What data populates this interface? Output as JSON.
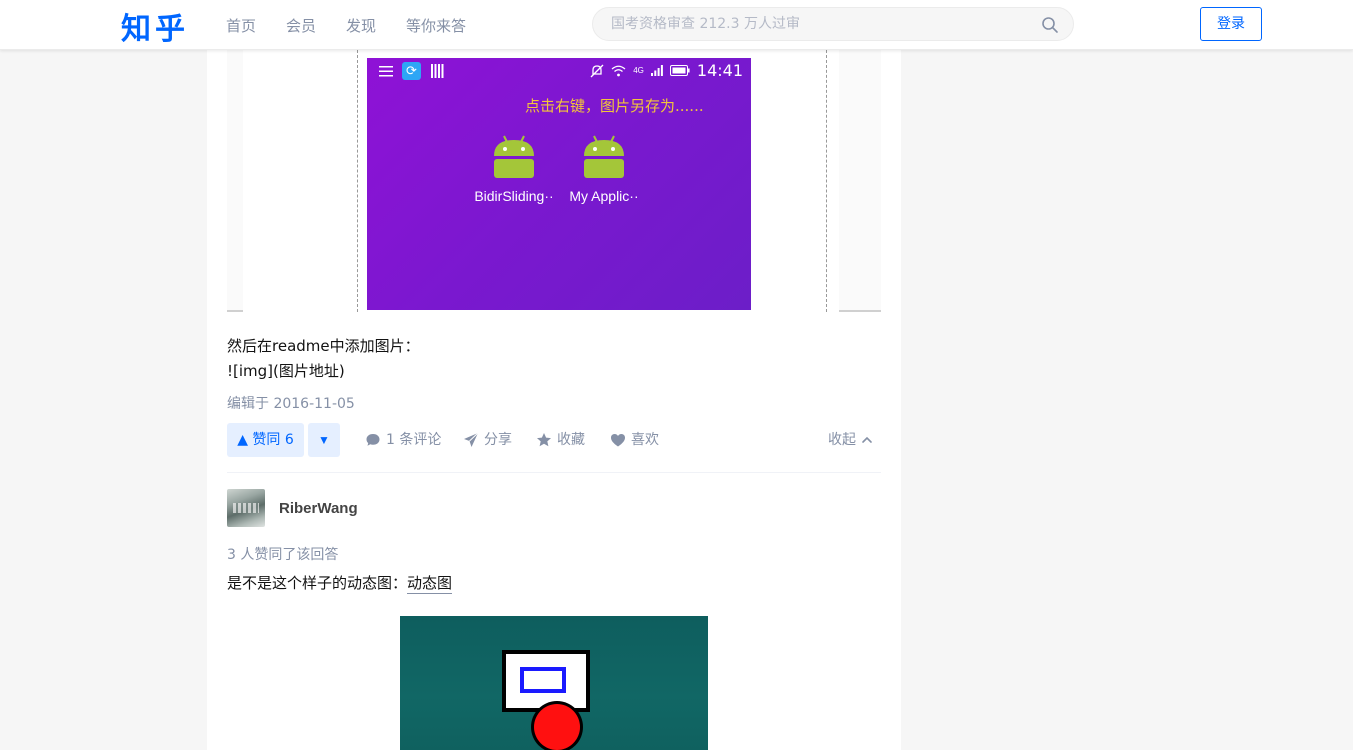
{
  "header": {
    "logo": "知乎",
    "nav": [
      "首页",
      "会员",
      "发现",
      "等你来答"
    ],
    "search_placeholder": "国考资格审查 212.3 万人过审",
    "login_label": "登录"
  },
  "phone_screenshot": {
    "status_time": "14:41",
    "network": "4G",
    "hint": "点击右键，图片另存为......",
    "apps": [
      "BidirSliding··",
      "My Applic··"
    ],
    "android_green": "#a4c639"
  },
  "answer": {
    "line1": "然后在readme中添加图片：",
    "line2": "![img](图片地址)",
    "edited": "编辑于 2016-11-05",
    "vote_up": "▲ 赞同 6",
    "vote_down": "▼",
    "comment": "1 条评论",
    "share": "分享",
    "favorite": "收藏",
    "like": "喜欢",
    "collapse": "收起"
  },
  "next_answer": {
    "author": "RiberWang",
    "voters": "3 人赞同了该回答",
    "text_prefix": "是不是这个样子的动态图：",
    "link": "动态图"
  },
  "colors": {
    "brand": "#0066ff",
    "muted": "#8590a6",
    "page_bg": "#f6f6f6"
  }
}
